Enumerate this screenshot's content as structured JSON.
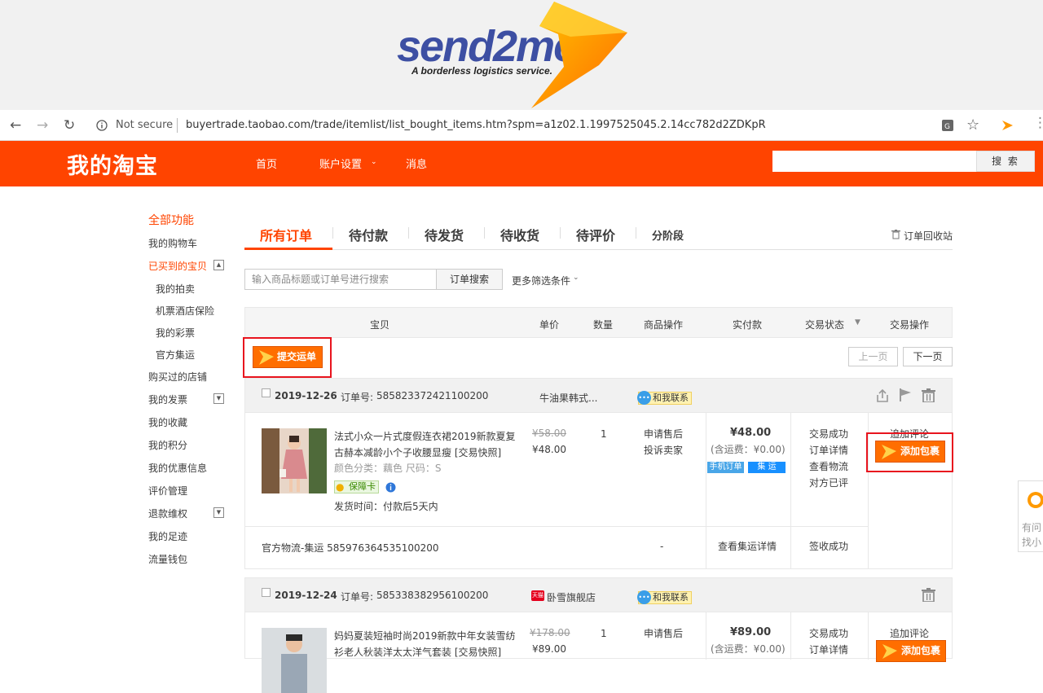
{
  "banner": {
    "brand": "send2me",
    "tagline": "A borderless logistics service."
  },
  "browser": {
    "security": "Not secure",
    "url": "buyertrade.taobao.com/trade/itemlist/list_bought_items.htm?spm=a1z02.1.1997525045.2.14cc782d2ZDKpR"
  },
  "header": {
    "logo": "我的淘宝",
    "nav": [
      "首页",
      "账户设置",
      "消息"
    ],
    "search_btn": "搜 索"
  },
  "sidebar": {
    "items": [
      {
        "label": "全部功能"
      },
      {
        "label": "我的购物车"
      },
      {
        "label": "已买到的宝贝"
      },
      {
        "label": "我的拍卖"
      },
      {
        "label": "机票酒店保险"
      },
      {
        "label": "我的彩票"
      },
      {
        "label": "官方集运"
      },
      {
        "label": "购买过的店铺"
      },
      {
        "label": "我的发票"
      },
      {
        "label": "我的收藏"
      },
      {
        "label": "我的积分"
      },
      {
        "label": "我的优惠信息"
      },
      {
        "label": "评价管理"
      },
      {
        "label": "退款维权"
      },
      {
        "label": "我的足迹"
      },
      {
        "label": "流量钱包"
      }
    ]
  },
  "tabs": [
    "所有订单",
    "待付款",
    "待发货",
    "待收货",
    "待评价",
    "分阶段"
  ],
  "recycle": "订单回收站",
  "filter": {
    "placeholder": "输入商品标题或订单号进行搜索",
    "search_btn": "订单搜索",
    "more": "更多筛选条件"
  },
  "columns": [
    "宝贝",
    "单价",
    "数量",
    "商品操作",
    "实付款",
    "交易状态",
    "交易操作"
  ],
  "submit_waybill": "提交运单",
  "pager": {
    "prev": "上一页",
    "next": "下一页"
  },
  "contact_label": "和我联系",
  "orders": [
    {
      "date": "2019-12-26",
      "order_no_label": "订单号:",
      "order_no": "585823372421100200",
      "shop": "牛油果韩式...",
      "title": "法式小众一片式度假连衣裙2019新款夏复古赫本减龄小个子收腰显瘦 [交易快照]",
      "attrs": "颜色分类：藕色   尺码：S",
      "guarantee": "保障卡",
      "ship_time": "发货时间：付款后5天内",
      "orig_price": "¥58.00",
      "price": "¥48.00",
      "qty": "1",
      "ops": [
        "申请售后",
        "投诉卖家"
      ],
      "paid": "¥48.00",
      "shipping": "(含运费：¥0.00)",
      "tags": [
        "手机订单",
        "集 运"
      ],
      "status": [
        "交易成功",
        "订单详情",
        "查看物流",
        "对方已评"
      ],
      "action": "追加评论",
      "add_package": "添加包裹",
      "logistics": "官方物流-集运   585976364535100200",
      "logistics_dash": "-",
      "logistics_link": "查看集运详情",
      "logistics_status": "签收成功"
    },
    {
      "date": "2019-12-24",
      "order_no_label": "订单号:",
      "order_no": "585338382956100200",
      "shop": "卧雪旗舰店",
      "shop_tag": "天猫",
      "title": "妈妈夏装短袖时尚2019新款中年女装雪纺衫老人秋装洋太太洋气套装 [交易快照]",
      "orig_price": "¥178.00",
      "price": "¥89.00",
      "qty": "1",
      "ops": [
        "申请售后"
      ],
      "paid": "¥89.00",
      "shipping": "(含运费：¥0.00)",
      "status": [
        "交易成功",
        "订单详情"
      ],
      "action": "追加评论",
      "add_package": "添加包裹"
    }
  ],
  "feedback": [
    "有问",
    "找小"
  ]
}
